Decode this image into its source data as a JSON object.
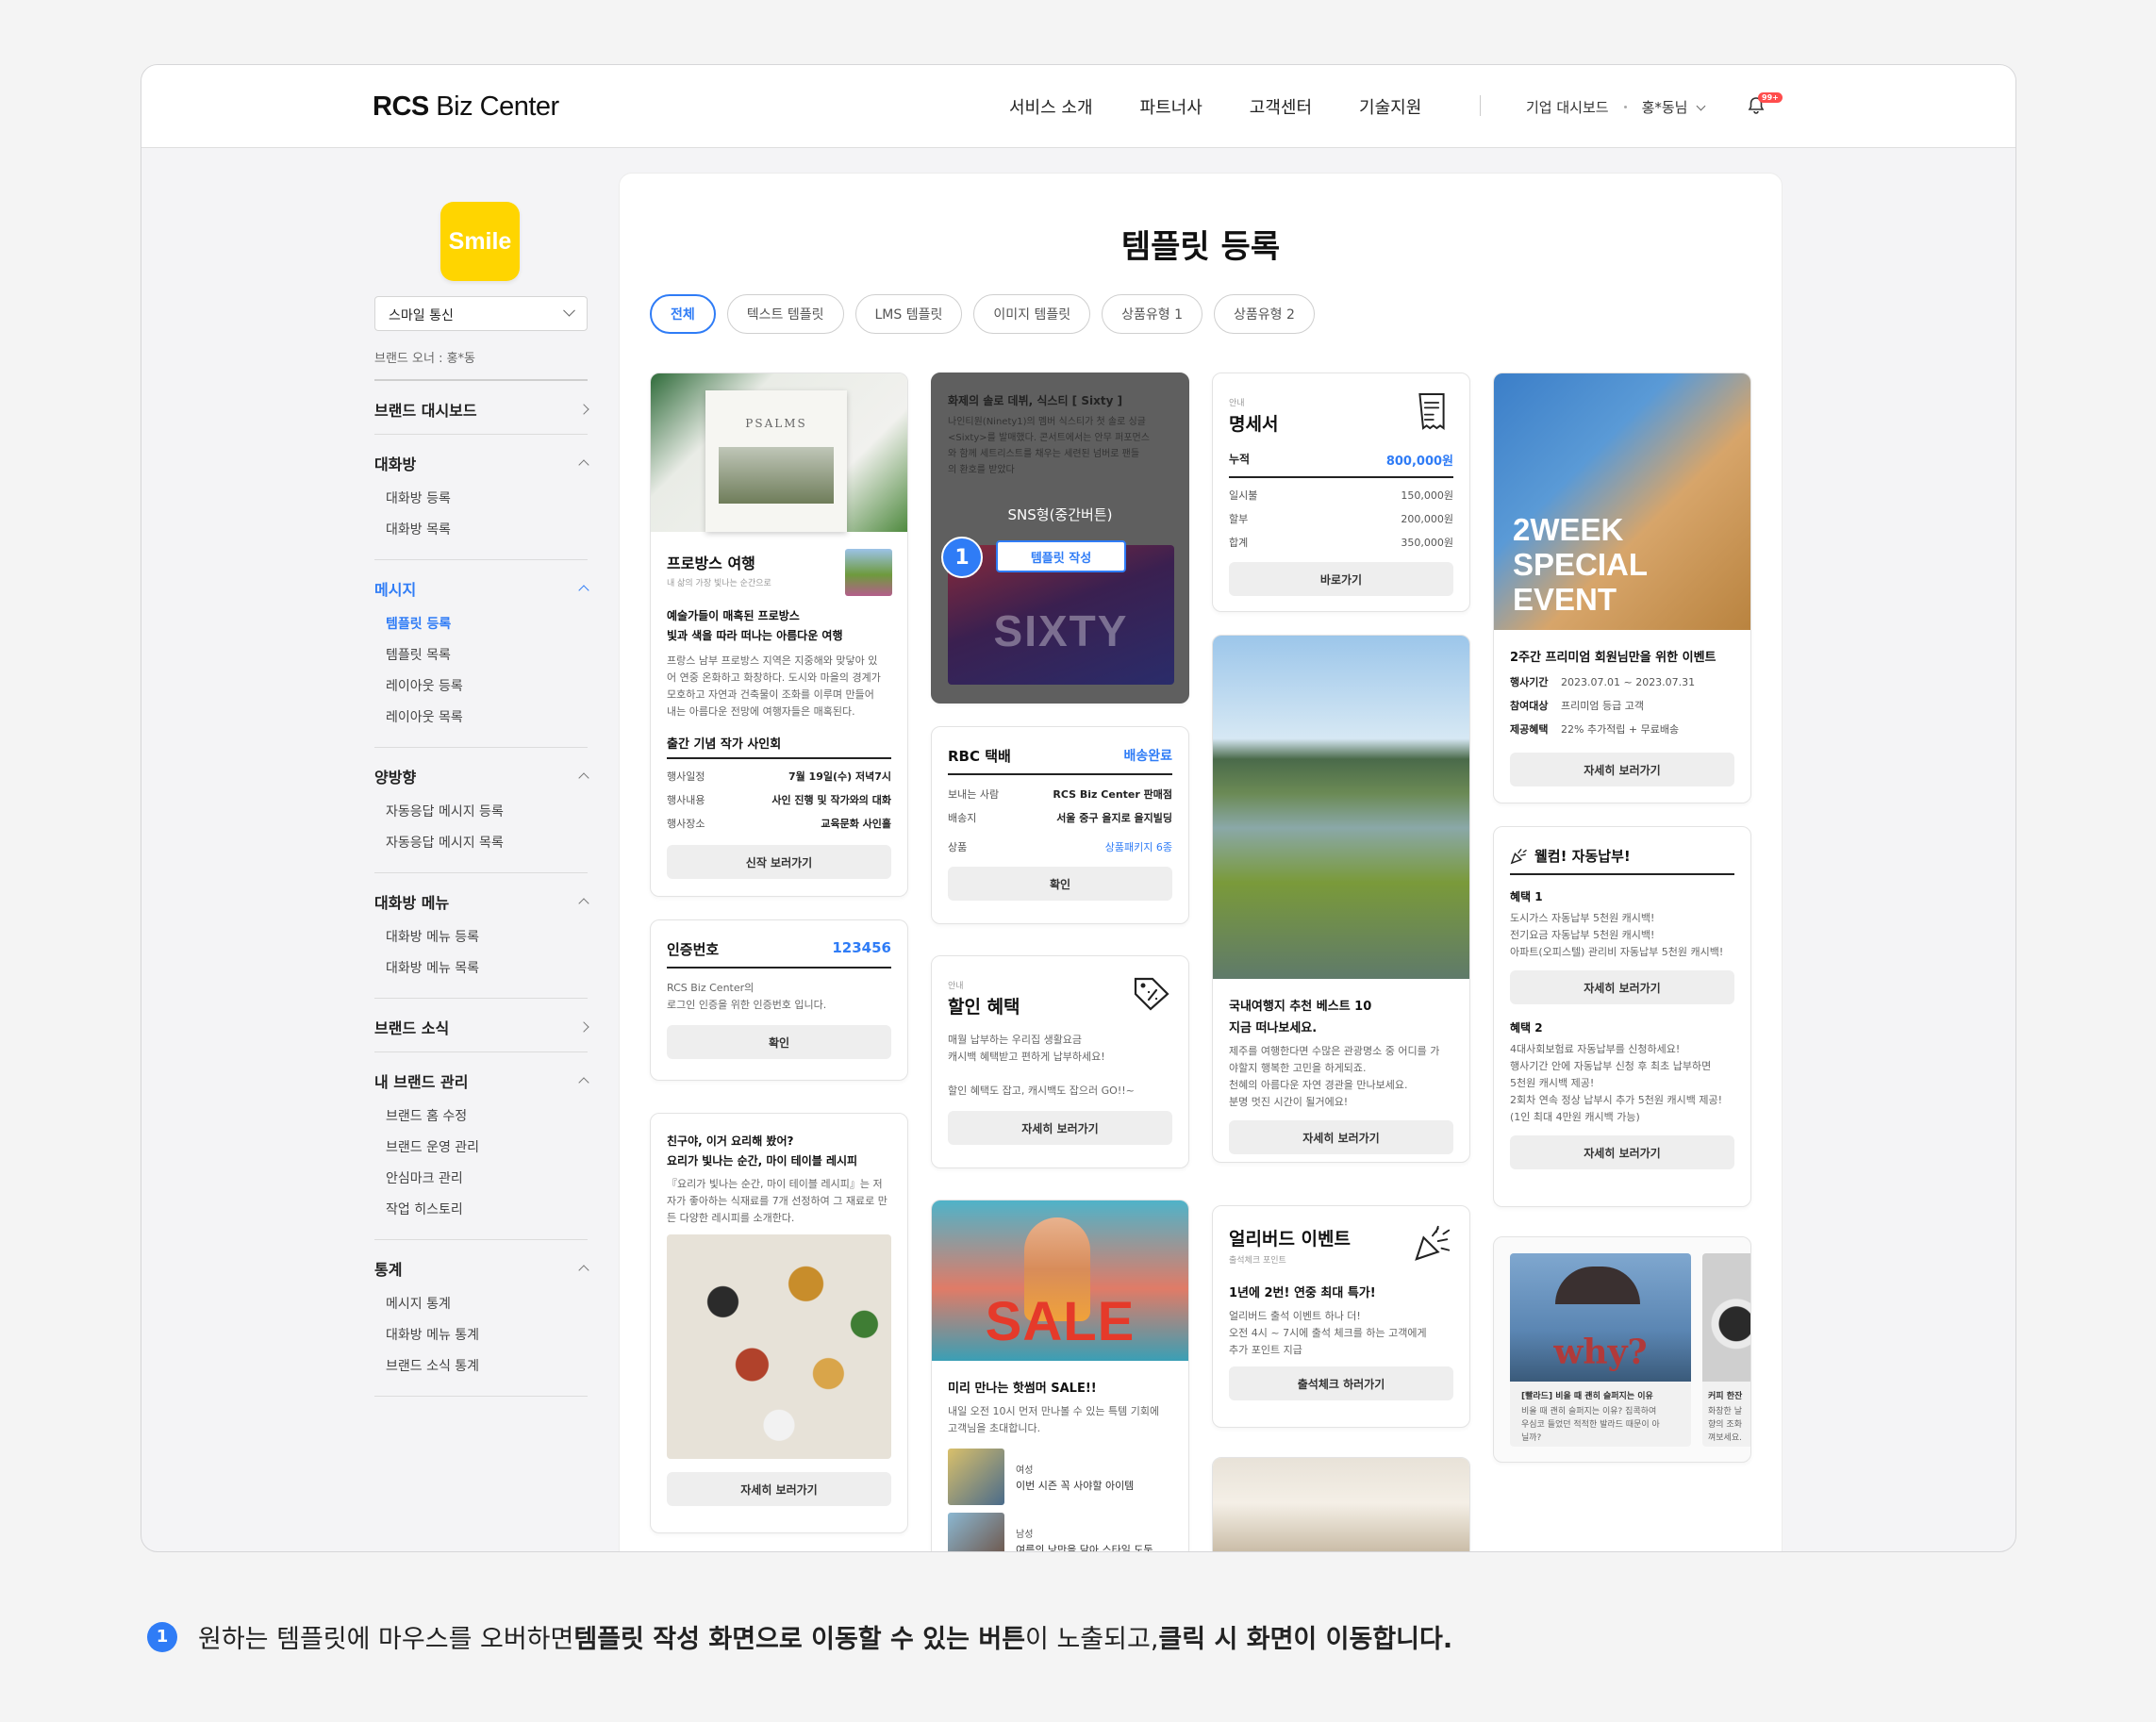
{
  "header": {
    "logo_bold": "RCS",
    "logo_light": " Biz Center",
    "nav": [
      "서비스 소개",
      "파트너사",
      "고객센터",
      "기술지원"
    ],
    "dashboard": "기업 대시보드",
    "user": "홍*동님",
    "badge": "99+"
  },
  "sidebar": {
    "logo_text": "Smile",
    "brand_select": "스마일 통신",
    "owner": "브랜드 오너 : 홍*동",
    "groups": [
      {
        "label": "브랜드 대시보드",
        "items": []
      },
      {
        "label": "대화방",
        "items": [
          "대화방 등록",
          "대화방 목록"
        ]
      },
      {
        "label": "메시지",
        "items": [
          "템플릿 등록",
          "템플릿 목록",
          "레이아웃 등록",
          "레이아웃 목록"
        ]
      },
      {
        "label": "양방향",
        "items": [
          "자동응답 메시지 등록",
          "자동응답 메시지 목록"
        ]
      },
      {
        "label": "대화방 메뉴",
        "items": [
          "대화방 메뉴 등록",
          "대화방 메뉴 목록"
        ]
      },
      {
        "label": "브랜드 소식",
        "items": []
      },
      {
        "label": "내 브랜드 관리",
        "items": [
          "브랜드 홈 수정",
          "브랜드 운영 관리",
          "안심마크 관리",
          "작업 히스토리"
        ]
      },
      {
        "label": "통계",
        "items": [
          "메시지 통계",
          "대화방 메뉴 통계",
          "브랜드 소식 통계"
        ]
      }
    ]
  },
  "page": {
    "title": "템플릿 등록",
    "tabs": [
      "전체",
      "텍스트 템플릿",
      "LMS 템플릿",
      "이미지 템플릿",
      "상품유형 1",
      "상품유형 2"
    ]
  },
  "cards": {
    "provence": {
      "img_text": "PSALMS",
      "title": "프로방스 여행",
      "sub": "내 삶의 가장 빛나는 순간으로",
      "head1": "예술가들이 매혹된 프로방스",
      "head2": "빛과 색을 따라 떠나는 아름다운 여행",
      "body": [
        "프랑스 남부 프로방스 지역은 지중해와 맞닿아 있",
        "어 연중 온화하고 화창하다. 도시와 마을의 경계가",
        "모호하고 자연과 건축물이 조화를 이루며 만들어",
        "내는 아름다운 전망에 여행자들은 매혹된다."
      ],
      "event": "출간 기념 작가 사인회",
      "rows": [
        [
          "행사일정",
          "7월 19일(수) 저녁7시"
        ],
        [
          "행사내용",
          "사인 진행 및 작가와의 대화"
        ],
        [
          "행사장소",
          "교육문화 사인홀"
        ]
      ],
      "btn": "신작 보러가기"
    },
    "auth": {
      "title": "인증번호",
      "code": "123456",
      "body": [
        "RCS Biz Center의",
        "로그인 인증을 위한 인증번호 입니다."
      ],
      "btn": "확인"
    },
    "recipe": {
      "head1": "친구야, 이거 요리해 봤어?",
      "head2": "요리가 빛나는 순간, 마이 테이블 레시피",
      "body": [
        "『요리가 빛나는 순간, 마이 테이블 레시피』는 저",
        "자가 좋아하는 식재료를 7개 선정하여 그 재료로 만",
        "든 다양한 레시피를 소개한다."
      ],
      "btn": "자세히 보러가기"
    },
    "sixty": {
      "head": "화제의 솔로 데뷔, 식스티 [ Sixty ]",
      "body": [
        "나인티원(Ninety1)의 멤버 식스티가 첫 솔로 싱글",
        "<Sixty>를 발매했다. 콘서트에서는 안무 퍼포먼스",
        "와 함께 세트리스트를 채우는 세련된 넘버로 팬들",
        "의 환호를 받았다"
      ],
      "overlay": "SNS형(중간버튼)",
      "btn": "템플릿 작성",
      "num": "1",
      "img_text": "SIXTY"
    },
    "delivery": {
      "title": "RBC 택배",
      "status": "배송완료",
      "rows": [
        [
          "보내는 사람",
          "RCS Biz Center 판매점"
        ],
        [
          "배송지",
          "서울 중구 을지로 을지빌딩"
        ],
        [
          "상품",
          "상품패키지 6종"
        ]
      ],
      "btn": "확인"
    },
    "discount": {
      "label": "안내",
      "title": "할인 혜택",
      "body": [
        "매월 납부하는 우리집 생활요금",
        "캐시백 혜택받고 편하게 납부하세요!"
      ],
      "body2": "할인 혜택도 잡고, 캐시백도 잡으러 GO!!~",
      "btn": "자세히 보러가기"
    },
    "sale": {
      "img_text": "SALE",
      "title": "미리 만나는 핫썸머 SALE!!",
      "body": [
        "내일 오전 10시 먼저 만나볼 수 있는 특템 기회에",
        "고객님을 초대합니다."
      ],
      "items": [
        {
          "g": "여성",
          "d": "이번 시즌 꼭 사야할 아이템"
        },
        {
          "g": "남성",
          "d": "여름의 낭만을 담아 스타일 도둑"
        }
      ]
    },
    "invoice": {
      "label": "안내",
      "title": "명세서",
      "total_label": "누적",
      "total": "800,000원",
      "rows": [
        [
          "일시불",
          "150,000원"
        ],
        [
          "할부",
          "200,000원"
        ],
        [
          "합계",
          "350,000원"
        ]
      ],
      "btn": "바로가기"
    },
    "travel": {
      "head1": "국내여행지 추천 베스트 10",
      "head2": "지금 떠나보세요.",
      "body": [
        "제주를 여행한다면 수많은 관광명소 중 어디를 가",
        "야할지 행복한 고민을 하게되죠.",
        "천혜의 아름다운 자연 경관을 만나보세요.",
        "분명 멋진 시간이 될거에요!"
      ],
      "btn": "자세히 보러가기"
    },
    "earlybird": {
      "title": "얼리버드 이벤트",
      "sub": "출석체크 포인트",
      "head": "1년에 2번! 연중 최대 특가!",
      "body": [
        "얼리버드 출석 이벤트 하나 더!",
        "오전 4시 ~ 7시에 출석 체크를 하는 고객에게",
        "추가 포인트 지급"
      ],
      "btn": "출석체크 하러가기"
    },
    "event2w": {
      "img_text": [
        "2WEEK",
        "SPECIAL",
        "EVENT"
      ],
      "title": "2주간 프리미엄 회원님만을 위한 이벤트",
      "rows": [
        [
          "행사기간",
          "2023.07.01 ~ 2023.07.31"
        ],
        [
          "참여대상",
          "프리미엄 등급 고객"
        ],
        [
          "제공혜택",
          "22% 추가적립 + 무료배송"
        ]
      ],
      "btn": "자세히 보러가기"
    },
    "autopay": {
      "title": "웰컴! 자동납부!",
      "b1": "혜택 1",
      "b1_body": [
        "도시가스 자동납부 5천원 캐시백!",
        "전기요금 자동납부 5천원 캐시백!",
        "아파트(오피스텔) 관리비 자동납부 5천원 캐시백!"
      ],
      "btn": "자세히 보러가기",
      "b2": "혜택 2",
      "b2_body": [
        "4대사회보험료 자동납부를 신청하세요!",
        "행사기간 안에 자동납부 신청 후 최초 납부하면",
        "5천원 캐시백 제공!",
        "2회차 연속 정상 납부시 추가 5천원 캐시백 제공!",
        "(1인 최대 4만원 캐시백 가능)"
      ]
    },
    "carousel": {
      "img_text": "why?",
      "c1_title": "[빨라드] 비올 때 괜히 슬퍼지는 이유",
      "c1_body": [
        "비올 때 괜히 슬퍼지는 이유? 집콕하여",
        "우심코 들었던 적적한 발라드 때문이 아",
        "닐까?"
      ],
      "c2_title": "커피 한잔",
      "c2_body": [
        "화창한 날",
        "향의 조화",
        "껴보세요."
      ]
    }
  },
  "footnote": {
    "num": "1",
    "t1": "원하는 템플릿에 마우스를 오버하면 ",
    "t2": "템플릿 작성 화면으로 이동할 수 있는 버튼",
    "t3": "이 노출되고, ",
    "t4": "클릭 시 화면이 이동합니다."
  },
  "colors": {
    "accent": "#2f7cf6",
    "brand_yellow": "#ffd500",
    "badge": "#ff4d4d"
  },
  "icons": [
    "chevron-down-icon",
    "chevron-right-icon",
    "chevron-up-icon",
    "bell-icon",
    "receipt-icon",
    "coupon-icon",
    "party-popper-icon"
  ]
}
